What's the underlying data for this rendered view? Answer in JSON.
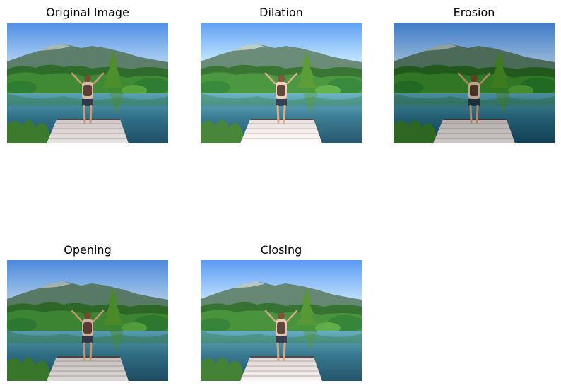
{
  "panels": [
    {
      "title": "Original Image"
    },
    {
      "title": "Dilation"
    },
    {
      "title": "Erosion"
    },
    {
      "title": "Opening"
    },
    {
      "title": "Closing"
    }
  ]
}
